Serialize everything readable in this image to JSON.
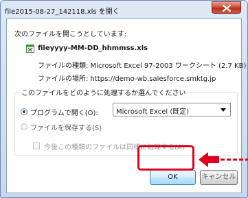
{
  "window": {
    "title": "file2015-08-27_142118.xls を開く",
    "close_icon": "close-icon"
  },
  "dialog": {
    "intro": "次のファイルを開こうとしています:",
    "file_name": "fileyyyy-MM-DD_hhmmss.xls",
    "file_icon": "excel-file-icon",
    "file_type_line": "ファイルの種類: Microsoft Excel 97-2003 ワークシート (2.7 KB)",
    "file_location_line": "ファイルの場所: https://demo-wb.salesforce.smktg.jp"
  },
  "action_group": {
    "legend": "このファイルをどのように処理するか選んでください",
    "open_with_label": "プログラムで開く(O):",
    "open_with_selected": true,
    "program_select_value": "Microsoft Excel (既定)",
    "save_file_label": "ファイルを保存する(S)",
    "save_file_selected": false,
    "remember_label": "今後この種類のファイルは同様に処理する(A)",
    "remember_checked": false
  },
  "buttons": {
    "ok_label": "OK",
    "cancel_label": "キャンセル"
  },
  "annotation": {
    "highlight_color": "#e0001b"
  }
}
